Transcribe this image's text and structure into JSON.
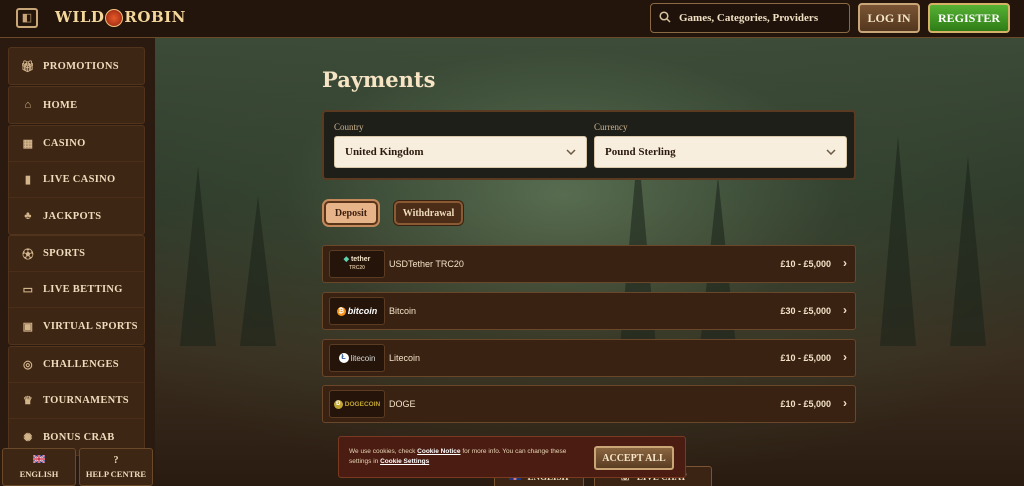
{
  "header": {
    "logo_text_left": "WILD",
    "logo_text_right": "ROBIN",
    "search_placeholder": "Games, Categories, Providers",
    "login_label": "LOG IN",
    "register_label": "REGISTER",
    "icons": {
      "menu": "sidebar-toggle-icon",
      "search": "search-icon"
    }
  },
  "sidebar": {
    "groups": [
      [
        {
          "label": "PROMOTIONS",
          "icon": "gift-icon"
        }
      ],
      [
        {
          "label": "HOME",
          "icon": "home-icon"
        }
      ],
      [
        {
          "label": "CASINO",
          "icon": "casino-icon"
        },
        {
          "label": "LIVE CASINO",
          "icon": "live-casino-icon"
        },
        {
          "label": "JACKPOTS",
          "icon": "clover-icon"
        }
      ],
      [
        {
          "label": "SPORTS",
          "icon": "ball-icon"
        },
        {
          "label": "LIVE BETTING",
          "icon": "live-icon"
        },
        {
          "label": "VIRTUAL SPORTS",
          "icon": "monitor-icon"
        }
      ],
      [
        {
          "label": "CHALLENGES",
          "icon": "target-icon"
        },
        {
          "label": "TOURNAMENTS",
          "icon": "trophy-icon"
        },
        {
          "label": "BONUS CRAB",
          "icon": "crab-icon"
        }
      ]
    ],
    "footer": {
      "language": "ENGLISH",
      "help": "HELP CENTRE"
    }
  },
  "main": {
    "title": "Payments",
    "country_label": "Country",
    "country_value": "United Kingdom",
    "currency_label": "Currency",
    "currency_value": "Pound Sterling",
    "tabs": [
      {
        "label": "Deposit",
        "active": true
      },
      {
        "label": "Withdrawal",
        "active": false
      }
    ],
    "methods": [
      {
        "logo": "tether",
        "logo_sub": "TRC20",
        "name": "USDTether TRC20",
        "range": "£10 - £5,000"
      },
      {
        "logo": "bitcoin",
        "name": "Bitcoin",
        "range": "£30 - £5,000"
      },
      {
        "logo": "litecoin",
        "name": "Litecoin",
        "range": "£10 - £5,000"
      },
      {
        "logo": "DOGECOIN",
        "name": "DOGE",
        "range": "£10 - £5,000"
      }
    ]
  },
  "cookie": {
    "text_1": "We use cookies, check ",
    "link_1": "Cookie Notice",
    "text_2": " for more info. You can change these settings in ",
    "link_2": "Cookie Settings",
    "accept_label": "ACCEPT ALL"
  },
  "bottom_bar": {
    "language": "ENGLISH",
    "live_chat": "LIVE CHAT"
  },
  "colors": {
    "accent_gold": "#c9a678",
    "register_green": "#3f9a22",
    "panel_brown": "#3a2213"
  }
}
